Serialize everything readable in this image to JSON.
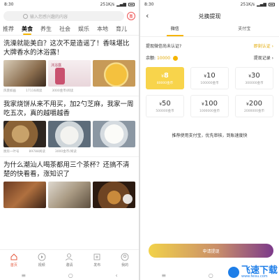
{
  "left": {
    "status": {
      "time": "8:30",
      "speed": "251K/s"
    },
    "search": {
      "placeholder": "输入您感兴趣的内容",
      "sign_label": "签"
    },
    "tabs": [
      "推荐",
      "美食",
      "养生",
      "社会",
      "娱乐",
      "本地",
      "育儿"
    ],
    "active_tab": "美食",
    "articles": [
      {
        "title": "洗澡就能美白？这次不是造谣了！香味堪比大牌香水的沐浴露！",
        "source": "风景如画",
        "reads": "17116阅读",
        "reward": "3000金币/阅读",
        "caption": "沐浴露"
      },
      {
        "title": "我家烧饼从来不用买，加2勺芝麻，我家一周吃五次，真的越嚼越香",
        "source": "厨房一叶号",
        "reads": "89788阅读",
        "reward": "3000金币/阅读"
      },
      {
        "title": "为什么潮汕人喝茶都用三个茶杯？还搞不清楚的快看看，涨知识了",
        "source": "",
        "reads": "",
        "reward": ""
      }
    ],
    "nav": [
      "首页",
      "视频",
      "邀请",
      "发布",
      "我的"
    ],
    "active_nav": "首页"
  },
  "right": {
    "status": {
      "time": "8:30",
      "speed": "251K/s"
    },
    "title": "兑换提现",
    "back": "‹",
    "pay_tabs": [
      "微信",
      "支付宝"
    ],
    "active_pay": "微信",
    "notice": "提现微信尚未认证?",
    "notice_link": "即刻认证 ›",
    "balance_label": "余额:",
    "balance_value": "10000",
    "records": "提现记录 ›",
    "options": [
      {
        "amount": "8",
        "coins": "80000金币",
        "selected": true
      },
      {
        "amount": "10",
        "coins": "100000金币",
        "selected": false
      },
      {
        "amount": "30",
        "coins": "300000金币",
        "selected": false
      },
      {
        "amount": "50",
        "coins": "500000金币",
        "selected": false
      },
      {
        "amount": "100",
        "coins": "1000000金币",
        "selected": false
      },
      {
        "amount": "200",
        "coins": "2000000金币",
        "selected": false
      }
    ],
    "currency": "¥",
    "tip": "推荐使用支付宝，优先审核，到账速度快",
    "apply": "申请提现",
    "watermark": "飞速下载",
    "watermark_sub": "www.feisu.com"
  },
  "colors": {
    "accent": "#f5b400",
    "active_nav": "#e4583d",
    "button_start": "#f2d24a",
    "button_end": "#7c3a8a"
  }
}
